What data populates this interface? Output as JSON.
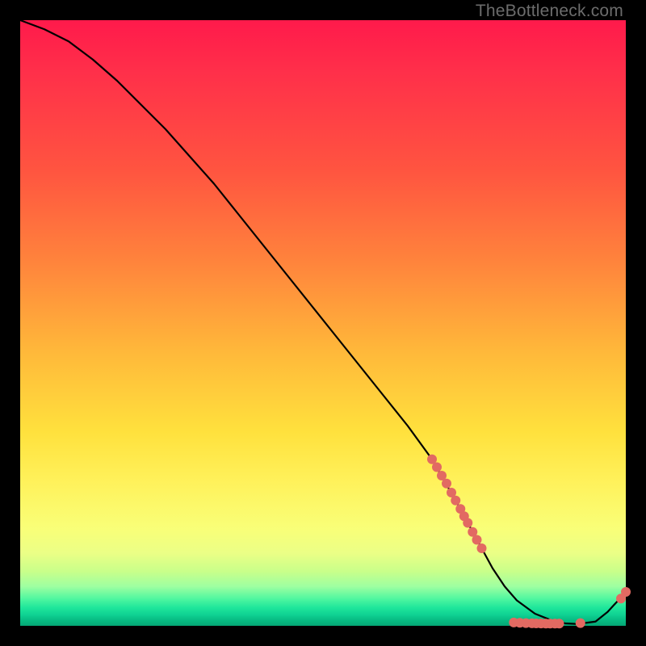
{
  "attribution": "TheBottleneck.com",
  "chart_data": {
    "type": "line",
    "title": "",
    "xlabel": "",
    "ylabel": "",
    "xlim": [
      0,
      100
    ],
    "ylim": [
      0,
      100
    ],
    "grid": false,
    "legend": false,
    "series": [
      {
        "name": "bottleneck-curve",
        "color": "#000000",
        "x": [
          0,
          4,
          8,
          12,
          16,
          20,
          24,
          28,
          32,
          36,
          40,
          44,
          48,
          52,
          56,
          60,
          64,
          68,
          70,
          72,
          75,
          78,
          80,
          82,
          85,
          88,
          90,
          92,
          95,
          97,
          98,
          100
        ],
        "y": [
          100,
          98.5,
          96.5,
          93.5,
          90,
          86,
          82,
          77.5,
          73,
          68,
          63,
          58,
          53,
          48,
          43,
          38,
          33,
          27.5,
          24,
          20.5,
          15,
          9.5,
          6.5,
          4.2,
          2.0,
          0.8,
          0.4,
          0.3,
          0.7,
          2.3,
          3.4,
          5.5
        ]
      }
    ],
    "markers": [
      {
        "name": "highlighted-points",
        "color": "#e26a62",
        "radius_px": 6,
        "points": [
          {
            "x": 68.0,
            "y": 27.5
          },
          {
            "x": 68.8,
            "y": 26.2
          },
          {
            "x": 69.6,
            "y": 24.8
          },
          {
            "x": 70.4,
            "y": 23.5
          },
          {
            "x": 71.2,
            "y": 22.0
          },
          {
            "x": 71.9,
            "y": 20.7
          },
          {
            "x": 72.7,
            "y": 19.3
          },
          {
            "x": 73.3,
            "y": 18.1
          },
          {
            "x": 73.9,
            "y": 17.0
          },
          {
            "x": 74.7,
            "y": 15.5
          },
          {
            "x": 75.4,
            "y": 14.2
          },
          {
            "x": 76.2,
            "y": 12.8
          },
          {
            "x": 81.5,
            "y": 0.55
          },
          {
            "x": 82.5,
            "y": 0.5
          },
          {
            "x": 83.5,
            "y": 0.45
          },
          {
            "x": 84.5,
            "y": 0.42
          },
          {
            "x": 85.2,
            "y": 0.4
          },
          {
            "x": 86.0,
            "y": 0.38
          },
          {
            "x": 86.8,
            "y": 0.37
          },
          {
            "x": 87.5,
            "y": 0.36
          },
          {
            "x": 88.3,
            "y": 0.36
          },
          {
            "x": 89.0,
            "y": 0.37
          },
          {
            "x": 92.5,
            "y": 0.45
          },
          {
            "x": 99.2,
            "y": 4.5
          },
          {
            "x": 100.0,
            "y": 5.6
          }
        ]
      }
    ]
  }
}
